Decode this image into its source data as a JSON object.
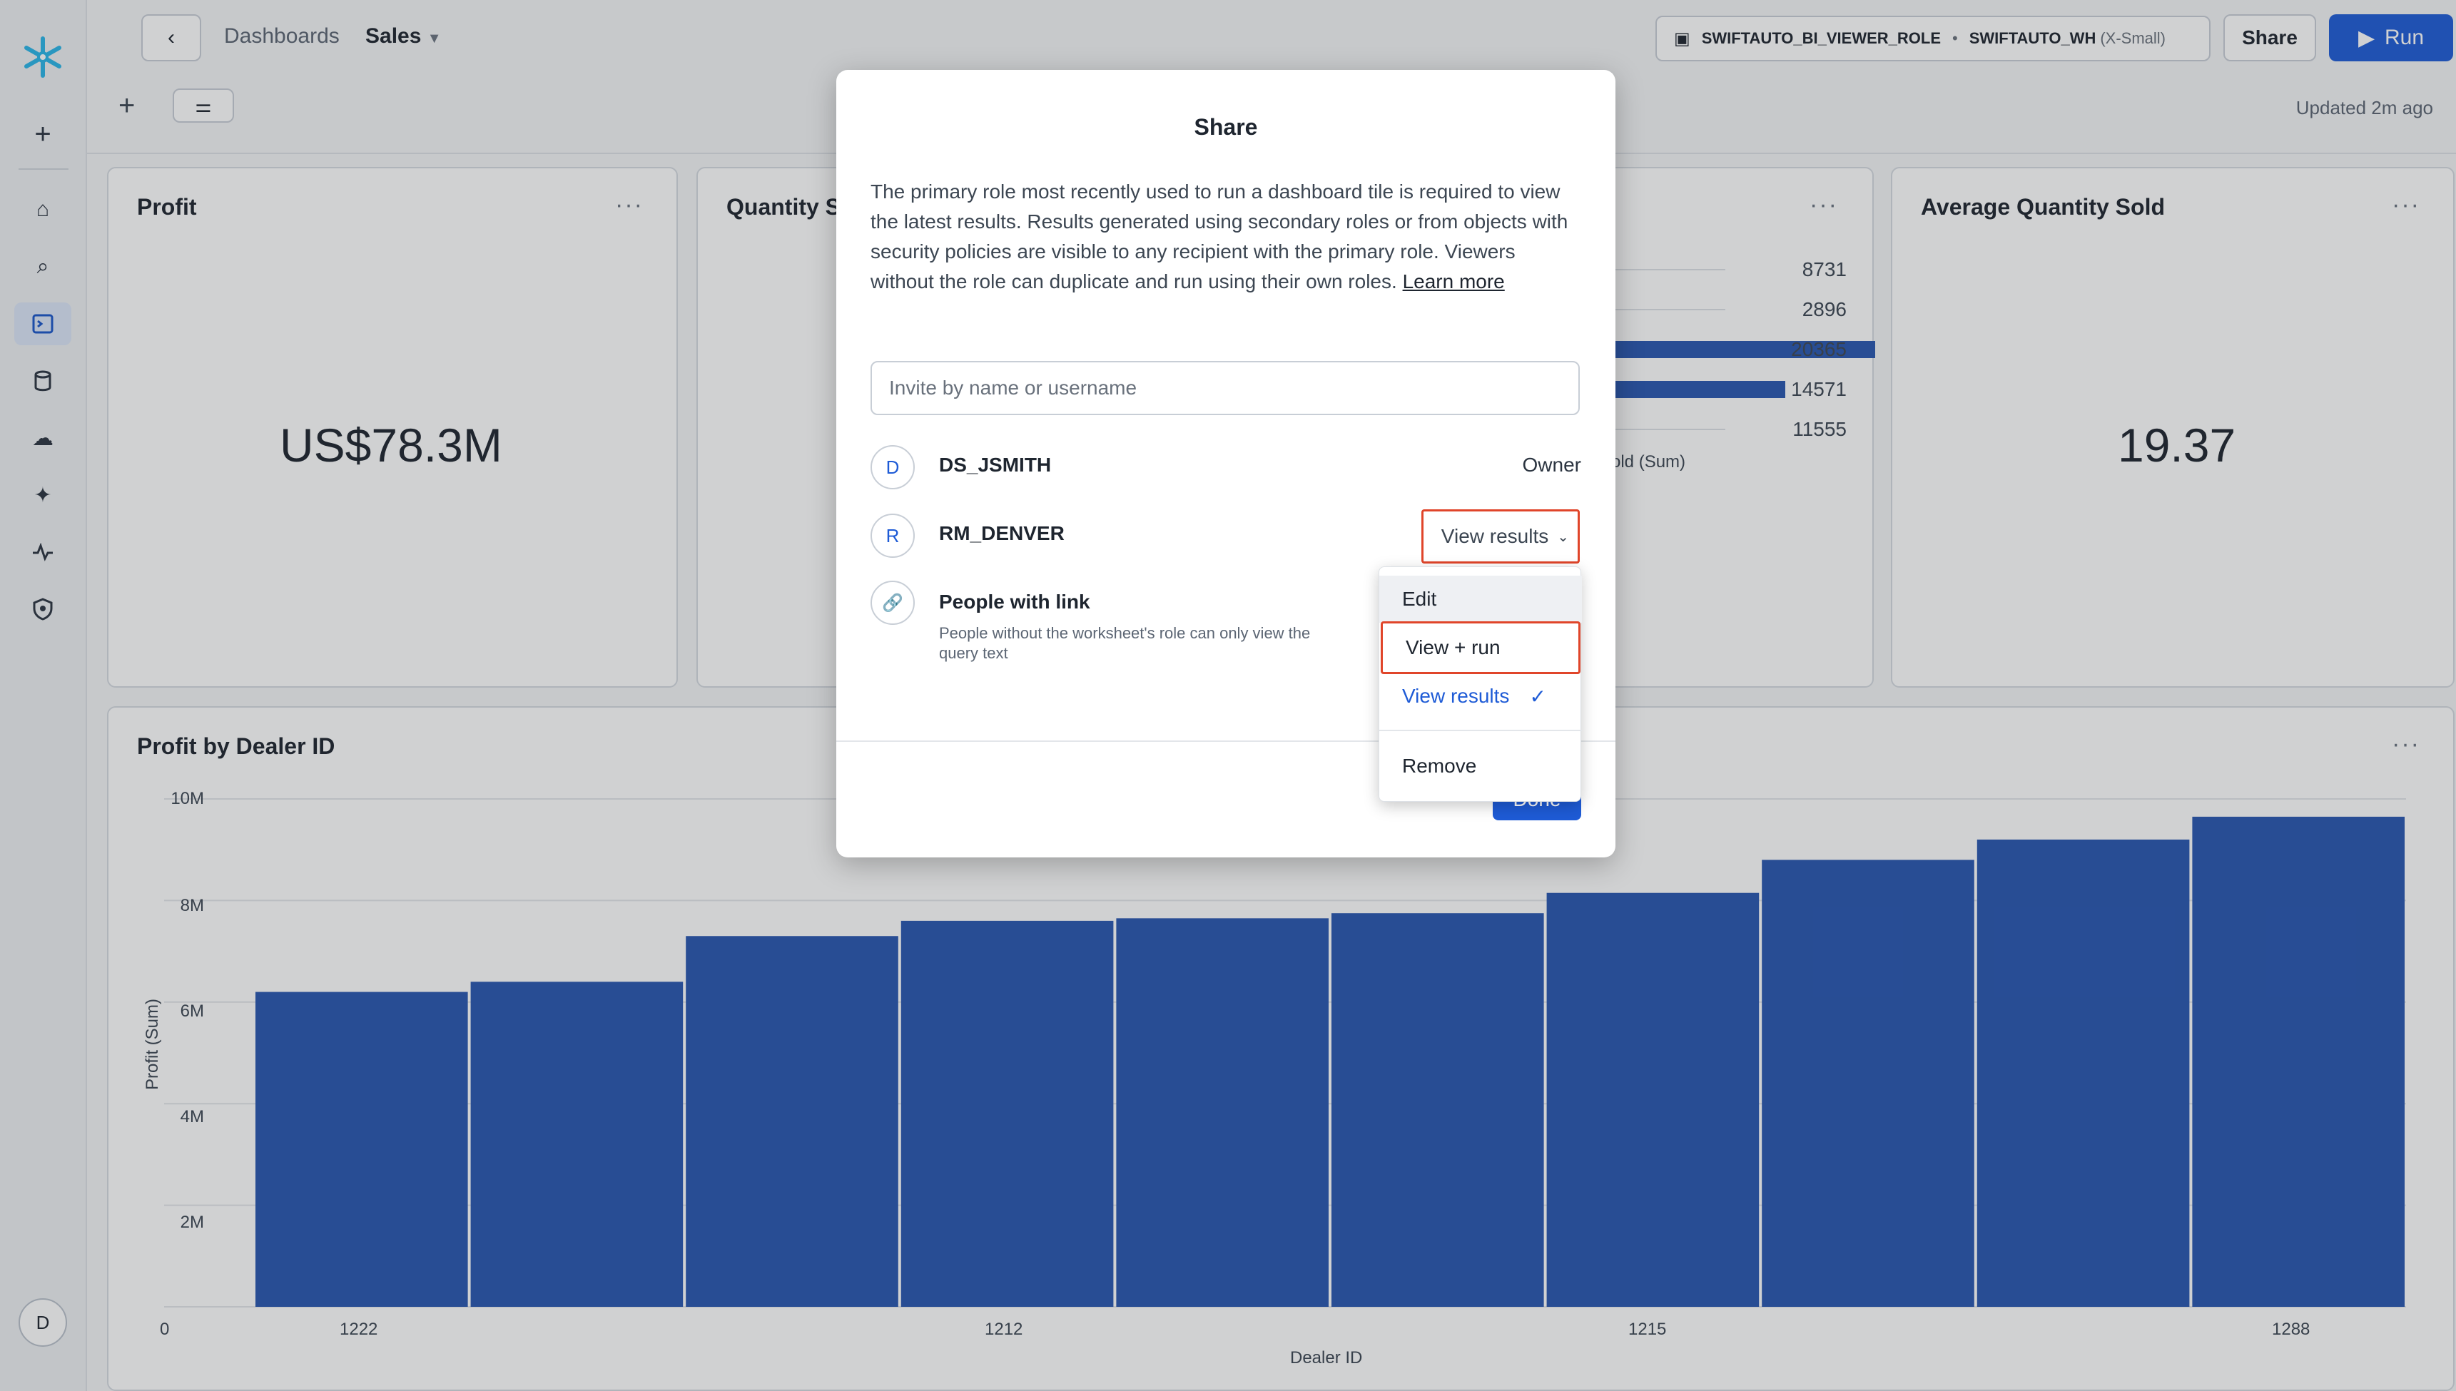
{
  "sidebar": {
    "logo": "snowflake-logo",
    "items": [
      "add",
      "home",
      "search",
      "worksheets",
      "data",
      "cloud",
      "ai",
      "monitoring",
      "admin"
    ],
    "user_initial": "D"
  },
  "header": {
    "breadcrumb_parent": "Dashboards",
    "dashboard_name": "Sales",
    "role": "SWIFTAUTO_BI_VIEWER_ROLE",
    "warehouse": "SWIFTAUTO_WH",
    "warehouse_size": "(X-Small)",
    "share_label": "Share",
    "run_label": "Run",
    "updated": "Updated 2m ago"
  },
  "tiles": [
    {
      "title": "Profit",
      "value": "US$78.3M"
    },
    {
      "title": "Quantity S"
    },
    {
      "title": ""
    },
    {
      "title": "Average Quantity Sold",
      "value": "19.37"
    }
  ],
  "mini_chart": {
    "values": [
      "8731",
      "2896",
      "20365",
      "14571",
      "11555"
    ],
    "axis_label": "old (Sum)"
  },
  "chart_data": {
    "type": "bar",
    "title": "Profit by Dealer ID",
    "xlabel": "Dealer ID",
    "ylabel": "Profit (Sum)",
    "x_tick_labels": [
      "1222",
      "1212",
      "1215",
      "1288"
    ],
    "y_tick_labels": [
      "0",
      "2M",
      "4M",
      "6M",
      "8M",
      "10M"
    ],
    "ylim": [
      0,
      10000000
    ],
    "values": [
      6200000,
      6400000,
      7300000,
      7600000,
      7650000,
      7750000,
      8150000,
      8800000,
      9200000,
      9650000
    ],
    "color": "#2856b0"
  },
  "modal": {
    "title": "Share",
    "description": "The primary role most recently used to run a dashboard tile is required to view the latest results. Results generated using secondary roles or from objects with security policies are visible to any recipient with the primary role. Viewers without the role can duplicate and run using their own roles.",
    "learn_more": "Learn more",
    "invite_placeholder": "Invite by name or username",
    "people": [
      {
        "initial": "D",
        "name": "DS_JSMITH",
        "permission": "Owner"
      },
      {
        "initial": "R",
        "name": "RM_DENVER",
        "permission": "View results"
      }
    ],
    "link": {
      "title": "People with link",
      "subtitle": "People without the worksheet's role can only view the query text"
    },
    "done_label": "Done"
  },
  "dropdown": {
    "items": [
      "Edit",
      "View + run",
      "View results",
      "Remove"
    ],
    "selected": "View results"
  },
  "colors": {
    "accent": "#1e5bd6",
    "highlight": "#e0452a",
    "bar": "#2856b0"
  }
}
